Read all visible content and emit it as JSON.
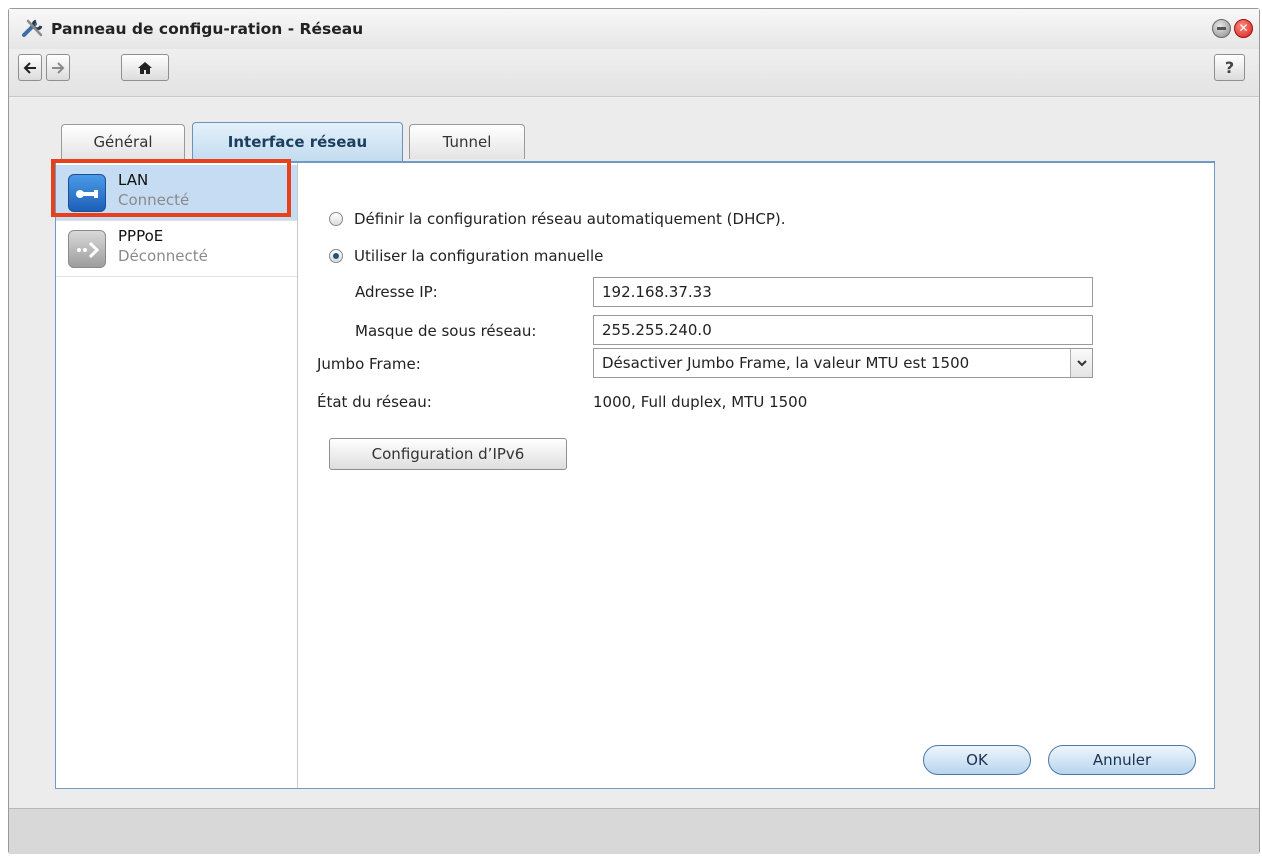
{
  "window": {
    "title": "Panneau de configu-ration - Réseau",
    "close_glyph": "✕"
  },
  "toolbar": {
    "back_icon": "arrow-left-icon",
    "forward_icon": "arrow-right-icon",
    "home_icon": "home-icon",
    "help_label": "?"
  },
  "tabs": [
    {
      "label": "Général",
      "active": false
    },
    {
      "label": "Interface réseau",
      "active": true
    },
    {
      "label": "Tunnel",
      "active": false
    }
  ],
  "sidebar": {
    "items": [
      {
        "name": "LAN",
        "status": "Connecté",
        "selected": true,
        "icon": "lan-icon"
      },
      {
        "name": "PPPoE",
        "status": "Déconnecté",
        "selected": false,
        "icon": "pppoe-icon"
      }
    ]
  },
  "form": {
    "dhcp_label": "Définir la configuration réseau automatiquement (DHCP).",
    "dhcp_selected": false,
    "manual_label": "Utiliser la configuration manuelle",
    "manual_selected": true,
    "ip_label": "Adresse IP:",
    "ip_value": "192.168.37.33",
    "mask_label": "Masque de sous réseau:",
    "mask_value": "255.255.240.0",
    "jumbo_label": "Jumbo Frame:",
    "jumbo_value": "Désactiver Jumbo Frame, la valeur MTU est 1500",
    "status_label": "État du réseau:",
    "status_value": "1000, Full duplex, MTU 1500",
    "ipv6_button": "Configuration d’IPv6"
  },
  "actions": {
    "ok_label": "OK",
    "cancel_label": "Annuler"
  },
  "colors": {
    "accent": "#6e9ac4",
    "highlight": "#e8401a",
    "selected_row": "#c6dcf2"
  }
}
